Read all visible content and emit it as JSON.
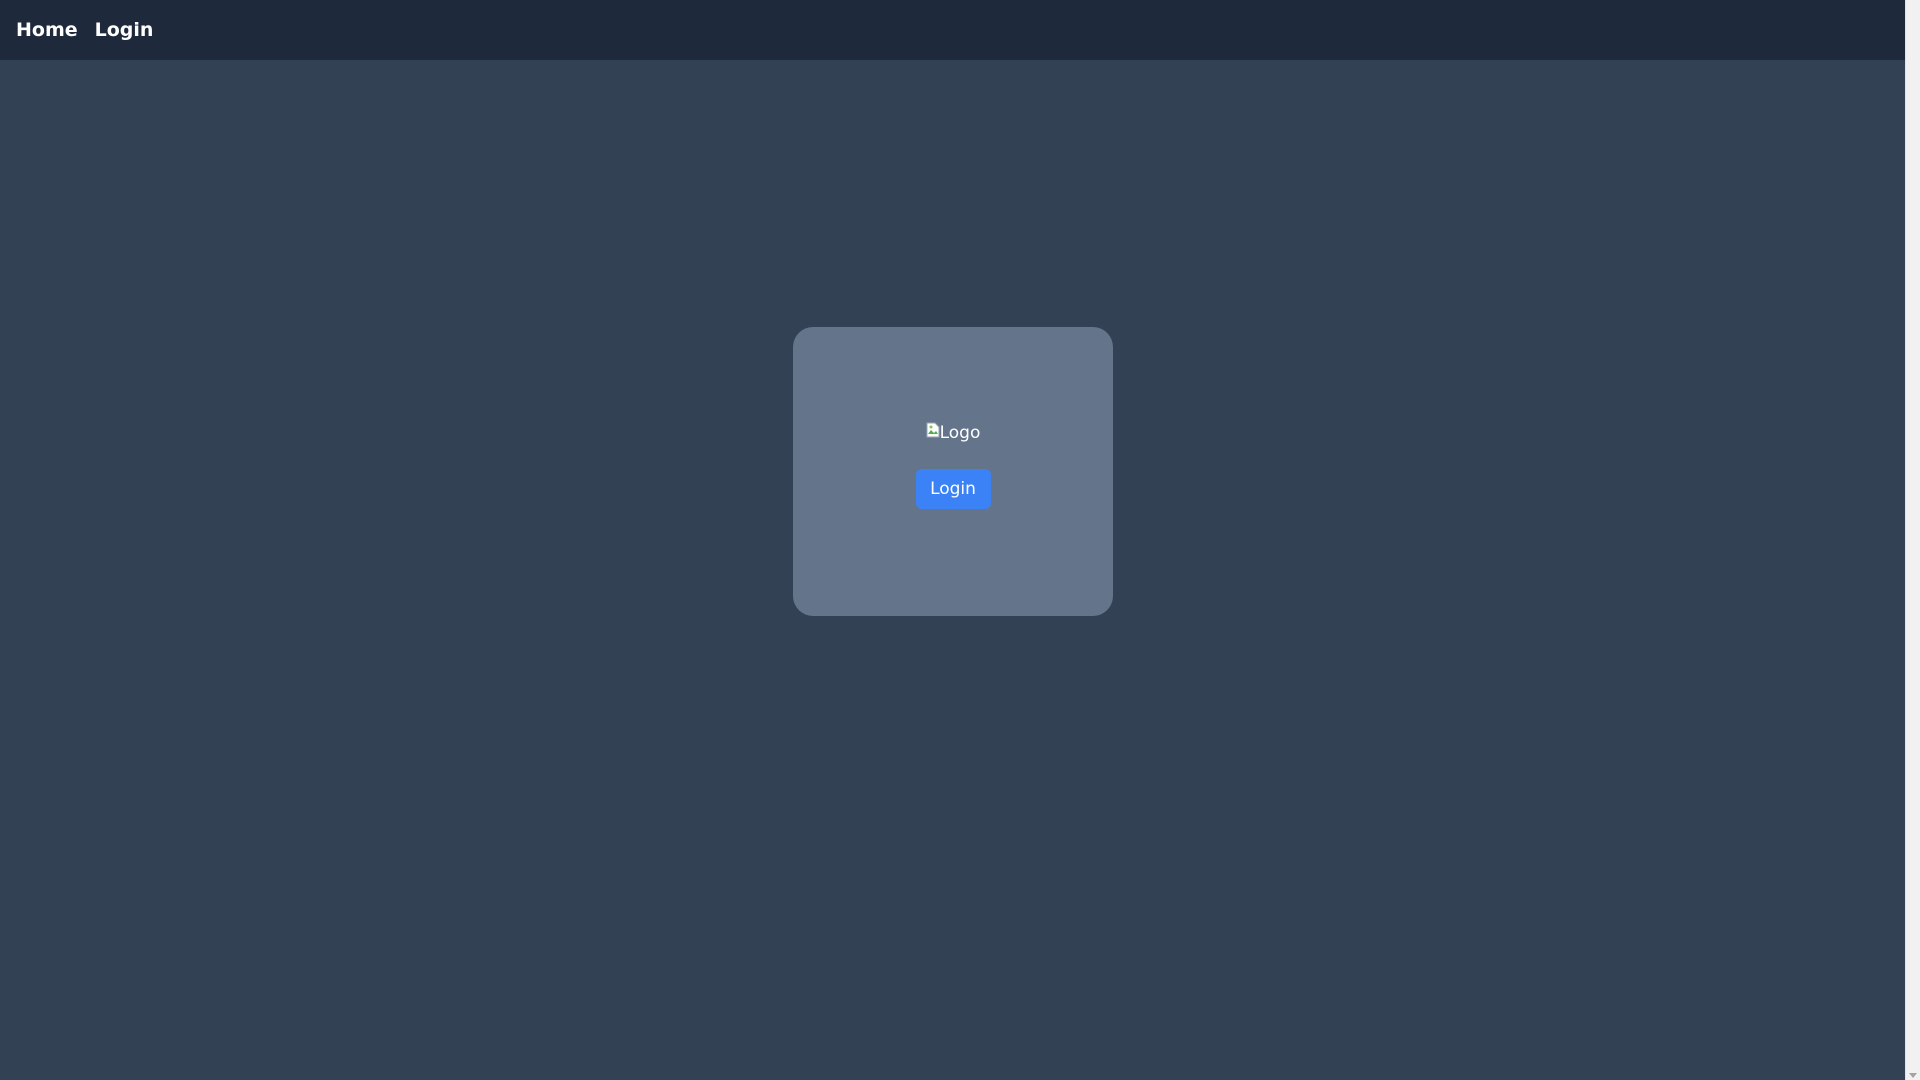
{
  "nav": {
    "home_label": "Home",
    "login_label": "Login"
  },
  "card": {
    "logo_alt": "Logo",
    "login_button_label": "Login"
  },
  "colors": {
    "page_bg": "#334155",
    "nav_bg": "#1e293b",
    "card_bg": "#64748b",
    "button_bg": "#3b82f6"
  },
  "icons": {
    "broken_image": "broken-image-icon",
    "scroll_down": "chevron-down-icon"
  }
}
